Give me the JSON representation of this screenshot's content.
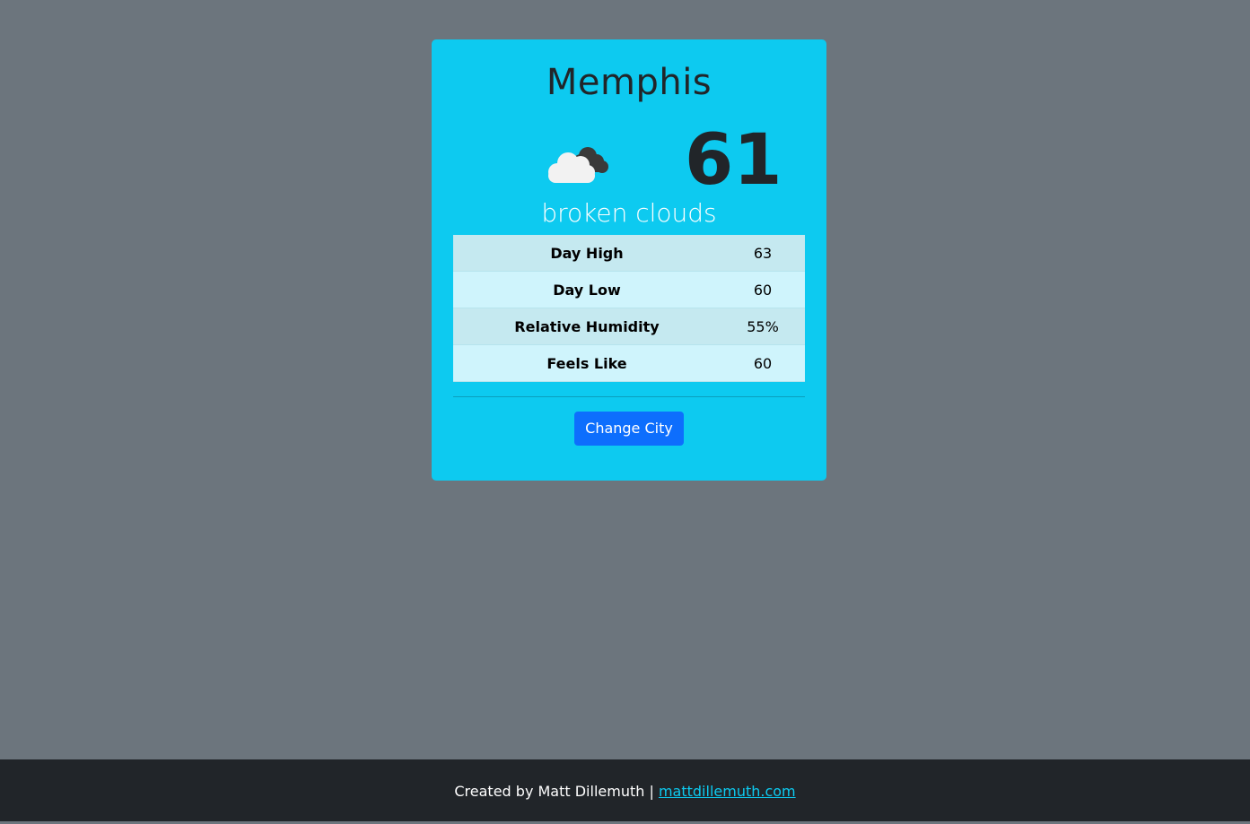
{
  "weather": {
    "city": "Memphis",
    "temperature": "61",
    "condition": "broken clouds",
    "icon": "broken-clouds-icon"
  },
  "details": [
    {
      "label": "Day High",
      "value": "63"
    },
    {
      "label": "Day Low",
      "value": "60"
    },
    {
      "label": "Relative Humidity",
      "value": "55%"
    },
    {
      "label": "Feels Like",
      "value": "60"
    }
  ],
  "actions": {
    "change_city_label": "Change City"
  },
  "footer": {
    "prefix": "Created by Matt Dillemuth |",
    "link_text": "mattdillemuth.com"
  },
  "colors": {
    "page_background": "#6c757d",
    "card_background": "#0dcaf0",
    "button": "#0d6efd",
    "footer_background": "#212529",
    "link": "#0dcaf0"
  }
}
